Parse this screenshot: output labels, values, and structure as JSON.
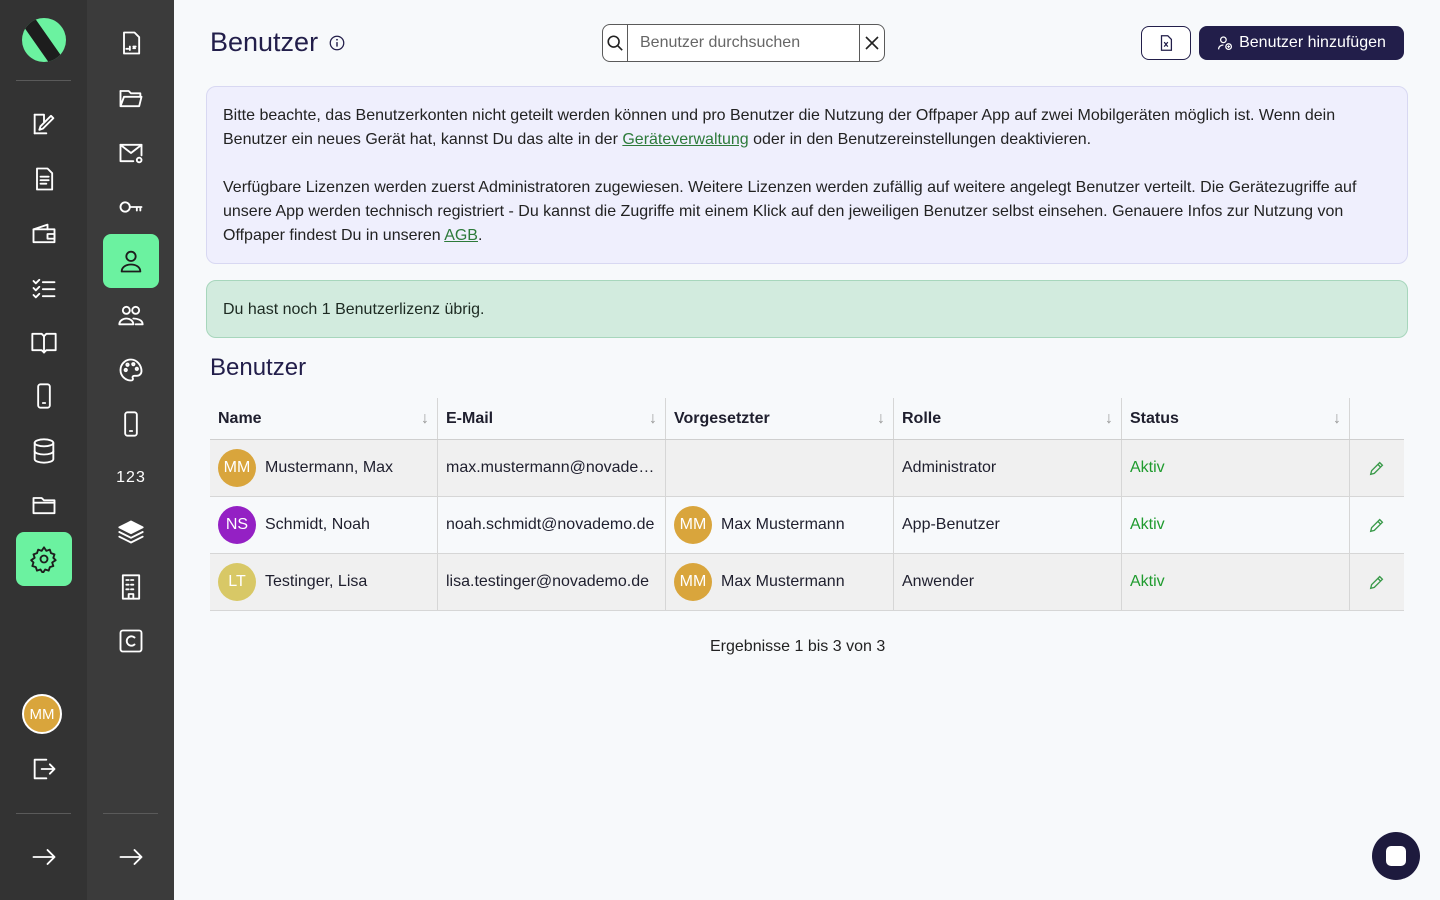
{
  "colors": {
    "accent_green": "#6bf2a0",
    "brand_dark": "#221e4a",
    "status_active": "#1f9b2e"
  },
  "sidebar": {
    "primary_items": [
      {
        "icon": "pen-edit-icon"
      },
      {
        "icon": "document-list-icon"
      },
      {
        "icon": "wallet-icon"
      },
      {
        "icon": "checklist-icon"
      },
      {
        "icon": "book-icon"
      },
      {
        "icon": "mobile-phone-icon"
      },
      {
        "icon": "database-icon"
      },
      {
        "icon": "folder-icon"
      },
      {
        "icon": "gear-icon",
        "active": true
      }
    ],
    "user_initials": "MM",
    "secondary_items": [
      {
        "icon": "pdf-file-icon"
      },
      {
        "icon": "folder-open-icon"
      },
      {
        "icon": "mail-at-icon"
      },
      {
        "icon": "key-icon"
      },
      {
        "icon": "user-icon",
        "active": true
      },
      {
        "icon": "users-icon"
      },
      {
        "icon": "palette-icon"
      },
      {
        "icon": "mobile-phone-icon"
      },
      {
        "icon": "numbers-text",
        "text": "123"
      },
      {
        "icon": "layers-icon"
      },
      {
        "icon": "building-icon"
      },
      {
        "icon": "copyright-box-icon"
      }
    ]
  },
  "header": {
    "title": "Benutzer",
    "search_placeholder": "Benutzer durchsuchen",
    "add_button_label": "Benutzer hinzufügen"
  },
  "notice": {
    "p1_before_link": "Bitte beachte, das Benutzerkonten nicht geteilt werden können und pro Benutzer die Nutzung der Offpaper App auf zwei Mobilgeräten möglich ist. Wenn dein Benutzer ein neues Gerät hat, kannst Du das alte in der ",
    "p1_link": "Geräteverwaltung",
    "p1_after_link": " oder in den Benutzereinstellungen deaktivieren.",
    "p2_before_link": "Verfügbare Lizenzen werden zuerst Administratoren zugewiesen. Weitere Lizenzen werden zufällig auf weitere angelegt Benutzer verteilt. Die Gerätezugriffe auf unsere App werden technisch registriert - Du kannst die Zugriffe mit einem Klick auf den jeweiligen Benutzer selbst einsehen. Genauere Infos zur Nutzung von Offpaper findest Du in unseren ",
    "p2_link": "AGB",
    "p2_after_link": "."
  },
  "license_text": "Du hast noch 1 Benutzerlizenz übrig.",
  "section_title": "Benutzer",
  "table": {
    "columns": [
      "Name",
      "E-Mail",
      "Vorgesetzter",
      "Rolle",
      "Status"
    ],
    "rows": [
      {
        "initials": "MM",
        "avatar_color": "#d9a53c",
        "name": "Mustermann, Max",
        "email": "max.mustermann@novade…",
        "manager_initials": "",
        "manager": "",
        "role": "Administrator",
        "status": "Aktiv"
      },
      {
        "initials": "NS",
        "avatar_color": "#9420c4",
        "name": "Schmidt, Noah",
        "email": "noah.schmidt@novademo.de",
        "manager_initials": "MM",
        "manager": "Max Mustermann",
        "role": "App-Benutzer",
        "status": "Aktiv"
      },
      {
        "initials": "LT",
        "avatar_color": "#d8c866",
        "name": "Testinger, Lisa",
        "email": "lisa.testinger@novademo.de",
        "manager_initials": "MM",
        "manager": "Max Mustermann",
        "role": "Anwender",
        "status": "Aktiv"
      }
    ]
  },
  "pager_text": "Ergebnisse 1 bis 3 von 3"
}
